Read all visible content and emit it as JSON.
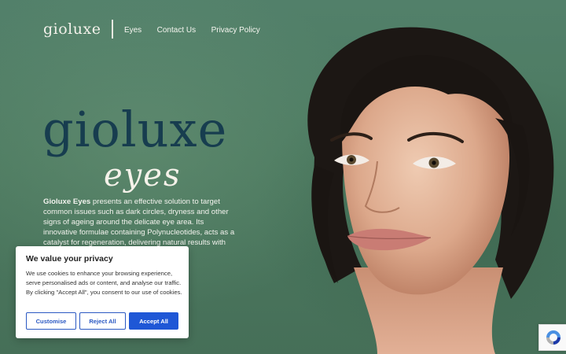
{
  "header": {
    "logo": "gioluxe",
    "nav": [
      "Eyes",
      "Contact Us",
      "Privacy Policy"
    ]
  },
  "hero": {
    "title": "gioluxe",
    "subtitle": "eyes",
    "brand": "Gioluxe Eyes",
    "body": " presents an effective solution to target common issues such as dark circles, dryness and other signs of ageing around the delicate eye area. Its innovative formulae containing Polynucleotides, acts as a catalyst for regeneration, delivering natural results with each application."
  },
  "cookie": {
    "title": "We value your privacy",
    "text": "We use cookies to enhance your browsing experience, serve personalised ads or content, and analyse our traffic. By clicking \"Accept All\", you consent to our use of cookies.",
    "customise": "Customise",
    "reject": "Reject All",
    "accept": "Accept All"
  },
  "colors": {
    "background": "#4f7a5e",
    "title": "#173d4f",
    "accept": "#1f57d6"
  },
  "icons": [
    "recaptcha-icon"
  ]
}
